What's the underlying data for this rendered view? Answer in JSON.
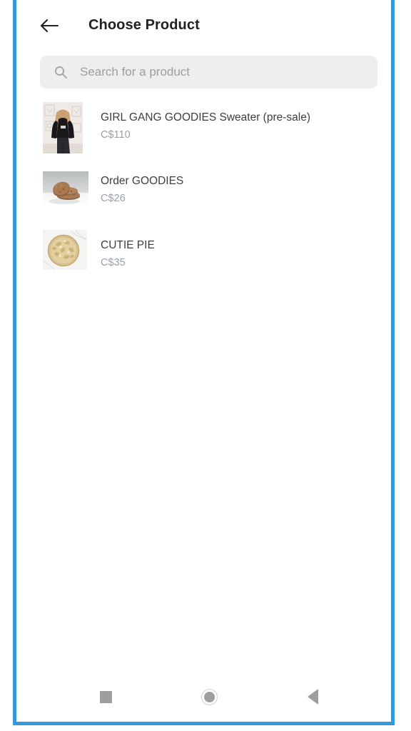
{
  "app": {
    "title": "Choose Product",
    "back_icon": "arrow-left-icon",
    "accent_color": "#3498db"
  },
  "search": {
    "icon": "search-icon",
    "placeholder": "Search for a product",
    "value": ""
  },
  "products": [
    {
      "name": "GIRL GANG GOODIES Sweater (pre-sale)",
      "price": "C$110",
      "thumbnail": "sweater-photo"
    },
    {
      "name": "Order GOODIES",
      "price": "C$26",
      "thumbnail": "cookies-photo"
    },
    {
      "name": "CUTIE PIE",
      "price": "C$35",
      "thumbnail": "pie-photo"
    }
  ],
  "navbar": {
    "recents_icon": "square-recents-icon",
    "home_icon": "circle-home-icon",
    "back_icon": "triangle-back-icon",
    "icon_color": "#9e9e9e"
  }
}
